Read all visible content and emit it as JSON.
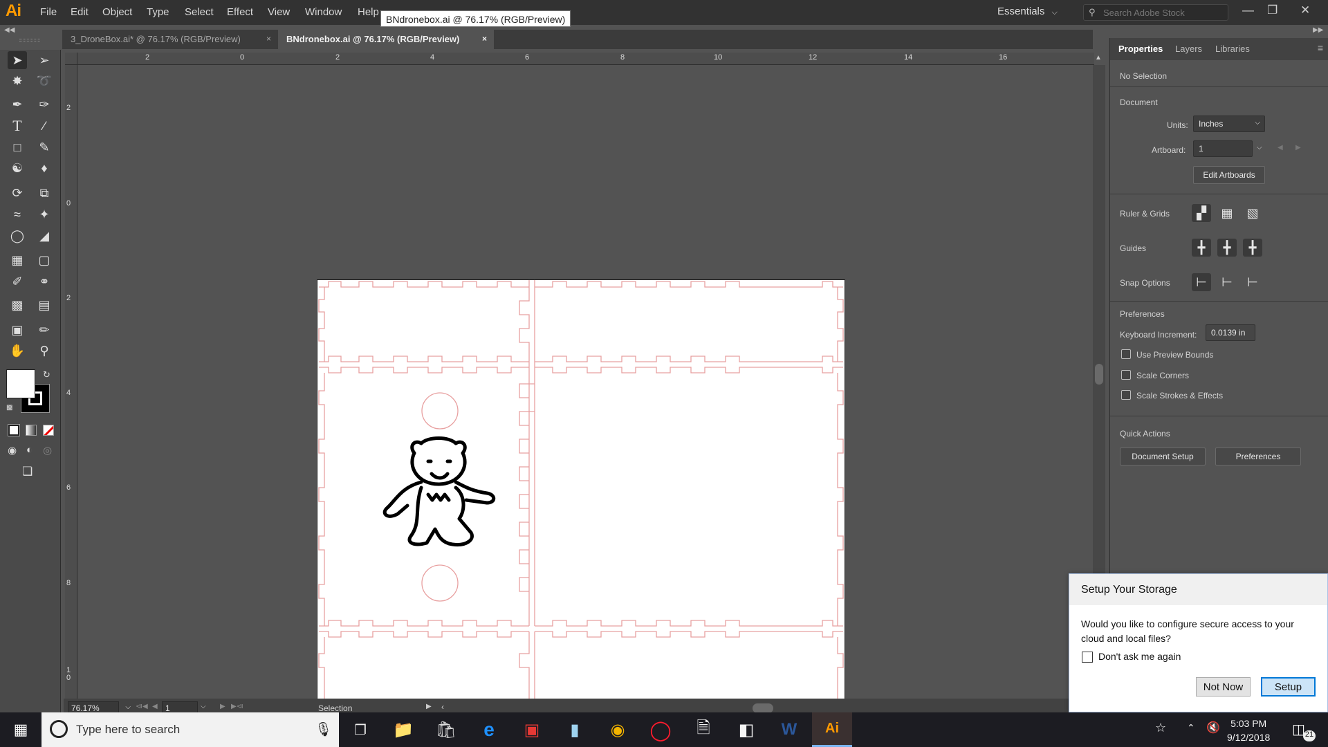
{
  "app": {
    "logo": "Ai"
  },
  "menu": [
    "File",
    "Edit",
    "Object",
    "Type",
    "Select",
    "Effect",
    "View",
    "Window",
    "Help"
  ],
  "tooltip": "BNdronebox.ai @ 76.17% (RGB/Preview)",
  "workspace": "Essentials",
  "stock_search": {
    "placeholder": "Search Adobe Stock"
  },
  "tabs": [
    {
      "label": "3_DroneBox.ai* @ 76.17% (RGB/Preview)",
      "close": "×"
    },
    {
      "label": "BNdronebox.ai @ 76.17% (RGB/Preview)",
      "close": "×"
    }
  ],
  "ruler": {
    "h": [
      "2",
      "0",
      "2",
      "4",
      "6",
      "8",
      "10",
      "12",
      "14",
      "16"
    ],
    "v": [
      "2",
      "0",
      "2",
      "4",
      "6",
      "8",
      "1\n0"
    ]
  },
  "status": {
    "zoom": "76.17%",
    "artboard": "1",
    "tool": "Selection"
  },
  "panel": {
    "tabs": [
      "Properties",
      "Layers",
      "Libraries"
    ],
    "no_selection": "No Selection",
    "document_heading": "Document",
    "units_label": "Units:",
    "units_value": "Inches",
    "artboard_label": "Artboard:",
    "artboard_value": "1",
    "edit_artboards": "Edit Artboards",
    "ruler_grids": "Ruler & Grids",
    "guides": "Guides",
    "snap_options": "Snap Options",
    "preferences_heading": "Preferences",
    "keyboard_increment_label": "Keyboard Increment:",
    "keyboard_increment_value": "0.0139 in",
    "checkboxes": [
      "Use Preview Bounds",
      "Scale Corners",
      "Scale Strokes & Effects"
    ],
    "quick_actions": "Quick Actions",
    "document_setup": "Document Setup",
    "preferences_button": "Preferences"
  },
  "dialog": {
    "title": "Setup Your Storage",
    "message": "Would you like to configure secure access to your cloud and local files?",
    "checkbox": "Don't ask me again",
    "not_now": "Not Now",
    "setup": "Setup"
  },
  "taskbar": {
    "search_placeholder": "Type here to search",
    "time": "5:03 PM",
    "date": "9/12/2018",
    "notifications": "21"
  },
  "colors": {
    "accent": "#ff9a00",
    "cut_line": "#e8a0a0",
    "panel_bg": "#535353"
  }
}
